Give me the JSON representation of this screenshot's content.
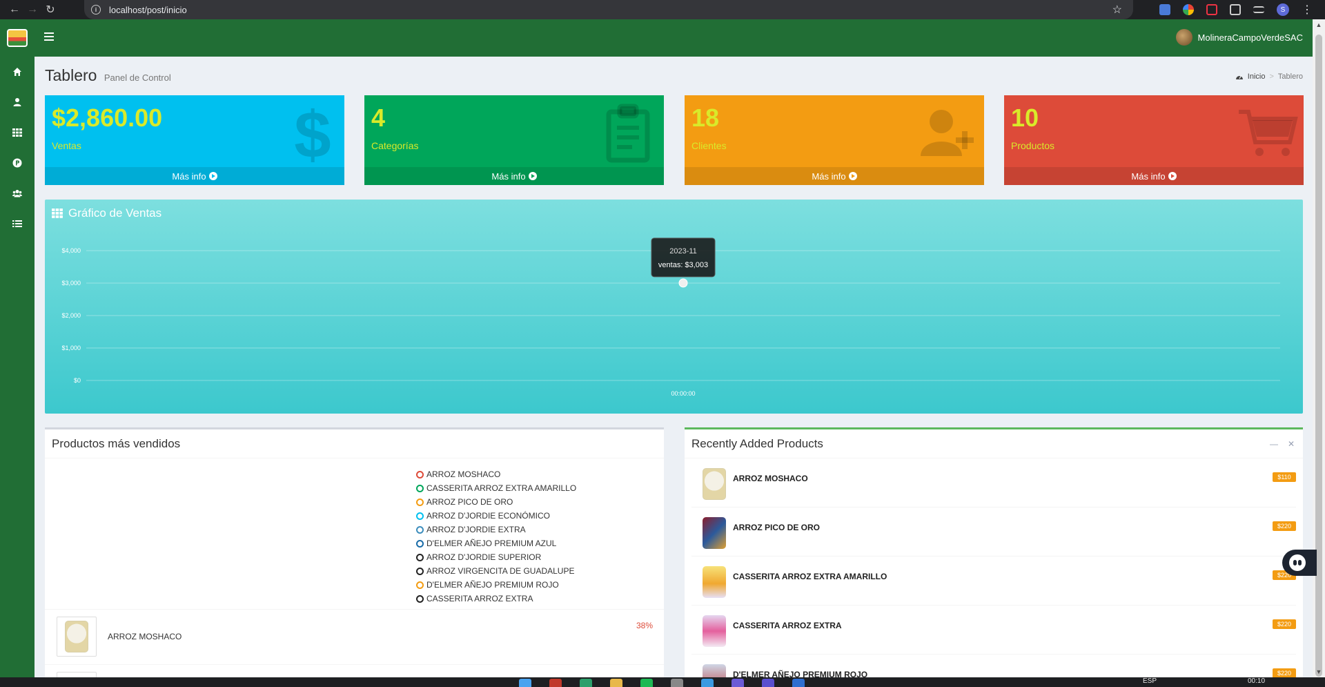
{
  "browser": {
    "url": "localhost/post/inicio",
    "profile_initial": "S"
  },
  "header": {
    "user_name": "MolineraCampoVerdeSAC"
  },
  "sidebar": {
    "items": [
      {
        "icon": "home-icon"
      },
      {
        "icon": "user-icon"
      },
      {
        "icon": "grid-icon"
      },
      {
        "icon": "p-circle-icon"
      },
      {
        "icon": "users-icon"
      },
      {
        "icon": "list-icon"
      }
    ]
  },
  "page": {
    "title": "Tablero",
    "subtitle": "Panel de Control"
  },
  "breadcrumb": {
    "home": "Inicio",
    "current": "Tablero"
  },
  "stats": [
    {
      "value": "$2,860.00",
      "label": "Ventas",
      "footer": "Más info",
      "color": "#00c0ef",
      "icon": "dollar-icon"
    },
    {
      "value": "4",
      "label": "Categorías",
      "footer": "Más info",
      "color": "#00a65a",
      "icon": "clipboard-icon"
    },
    {
      "value": "18",
      "label": "Clientes",
      "footer": "Más info",
      "color": "#f39c12",
      "icon": "user-plus-icon"
    },
    {
      "value": "10",
      "label": "Productos",
      "footer": "Más info",
      "color": "#dd4b39",
      "icon": "cart-icon"
    }
  ],
  "sales_chart": {
    "title": "Gráfico de Ventas",
    "tooltip_label": "2023-11",
    "tooltip_value": "ventas: $3,003"
  },
  "chart_data": {
    "type": "line",
    "title": "Gráfico de Ventas",
    "x": [
      "00:00:00"
    ],
    "series": [
      {
        "name": "ventas",
        "values": [
          3003
        ]
      }
    ],
    "yticks": [
      "$0",
      "$1,000",
      "$2,000",
      "$3,000",
      "$4,000"
    ],
    "ylim": [
      0,
      4000
    ],
    "grid": true
  },
  "top_products": {
    "title": "Productos más vendidos",
    "legend": [
      {
        "label": "ARROZ MOSHACO",
        "color": "#dd4b39"
      },
      {
        "label": "CASSERITA ARROZ EXTRA AMARILLO",
        "color": "#00a65a"
      },
      {
        "label": "ARROZ PICO DE ORO",
        "color": "#f39c12"
      },
      {
        "label": "ARROZ D'JORDIE ECONÓMICO",
        "color": "#00c0ef"
      },
      {
        "label": "ARROZ D'JORDIE EXTRA",
        "color": "#3c8dbc"
      },
      {
        "label": "D'ELMER AÑEJO PREMIUM AZUL",
        "color": "#1a6ca8"
      },
      {
        "label": "ARROZ D'JORDIE SUPERIOR",
        "color": "#222222"
      },
      {
        "label": "ARROZ VIRGENCITA DE GUADALUPE",
        "color": "#222222"
      },
      {
        "label": "D'ELMER AÑEJO PREMIUM ROJO",
        "color": "#f39c12"
      },
      {
        "label": "CASSERITA ARROZ EXTRA",
        "color": "#222222"
      }
    ],
    "rows": [
      {
        "name": "ARROZ MOSHACO",
        "percent": "38%"
      }
    ]
  },
  "recent_products": {
    "title": "Recently Added Products",
    "items": [
      {
        "name": "ARROZ MOSHACO",
        "price": "$110"
      },
      {
        "name": "ARROZ PICO DE ORO",
        "price": "$220"
      },
      {
        "name": "CASSERITA ARROZ EXTRA AMARILLO",
        "price": "$220"
      },
      {
        "name": "CASSERITA ARROZ EXTRA",
        "price": "$220"
      },
      {
        "name": "D'ELMER AÑEJO PREMIUM ROJO",
        "price": "$220"
      }
    ]
  },
  "taskbar": {
    "lang": "ESP",
    "time": "00:10"
  }
}
